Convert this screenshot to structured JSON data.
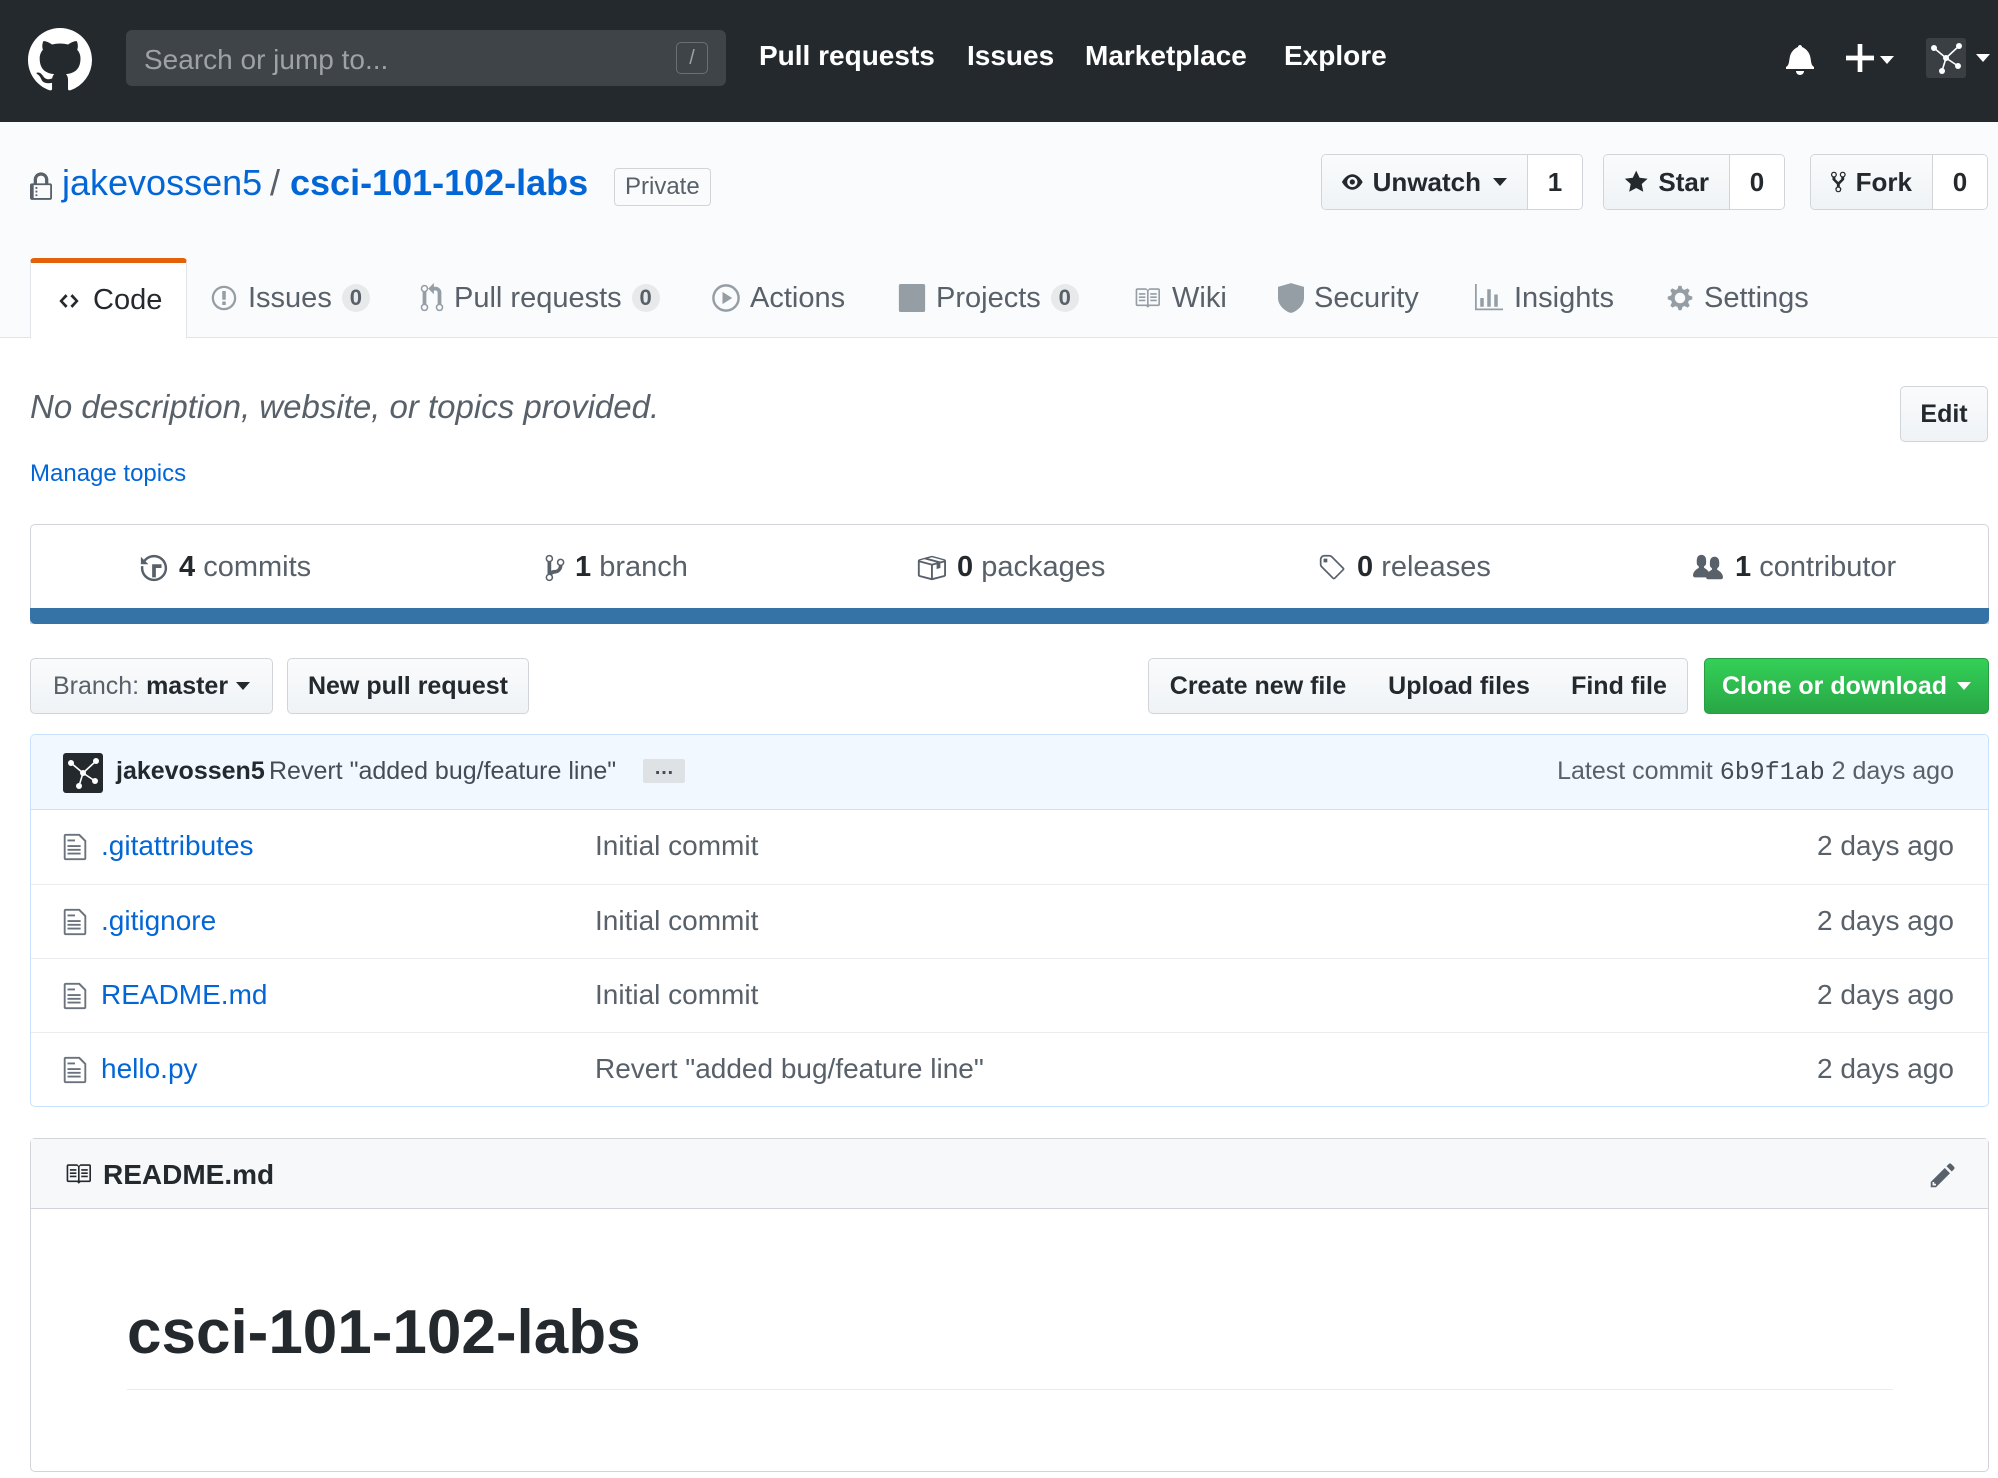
{
  "header": {
    "search_placeholder": "Search or jump to...",
    "search_shortcut": "/",
    "nav": [
      "Pull requests",
      "Issues",
      "Marketplace",
      "Explore"
    ],
    "icons": [
      "github-logo-icon",
      "bell-icon",
      "plus-icon",
      "avatar-icon"
    ]
  },
  "repo": {
    "owner": "jakevossen5",
    "separator": "/",
    "name": "csci-101-102-labs",
    "visibility": "Private",
    "unwatch_label": "Unwatch",
    "watch_count": "1",
    "star_label": "Star",
    "star_count": "0",
    "fork_label": "Fork",
    "fork_count": "0"
  },
  "tabs": [
    {
      "label": "Code",
      "icon": "code-icon",
      "counter": ""
    },
    {
      "label": "Issues",
      "icon": "issue-icon",
      "counter": "0"
    },
    {
      "label": "Pull requests",
      "icon": "pull-request-icon",
      "counter": "0"
    },
    {
      "label": "Actions",
      "icon": "play-icon",
      "counter": ""
    },
    {
      "label": "Projects",
      "icon": "project-icon",
      "counter": "0"
    },
    {
      "label": "Wiki",
      "icon": "book-icon",
      "counter": ""
    },
    {
      "label": "Security",
      "icon": "shield-icon",
      "counter": ""
    },
    {
      "label": "Insights",
      "icon": "graph-icon",
      "counter": ""
    },
    {
      "label": "Settings",
      "icon": "gear-icon",
      "counter": ""
    }
  ],
  "description": {
    "text": "No description, website, or topics provided.",
    "edit_label": "Edit",
    "manage_topics": "Manage topics"
  },
  "summary": [
    {
      "count": "4",
      "label": "commits",
      "icon": "history-icon"
    },
    {
      "count": "1",
      "label": "branch",
      "icon": "branch-icon"
    },
    {
      "count": "0",
      "label": "packages",
      "icon": "package-icon"
    },
    {
      "count": "0",
      "label": "releases",
      "icon": "tag-icon"
    },
    {
      "count": "1",
      "label": "contributor",
      "icon": "people-icon"
    }
  ],
  "language_color": "#3572a5",
  "file_nav": {
    "branch_prefix": "Branch:",
    "branch_name": "master",
    "new_pr": "New pull request",
    "create_file": "Create new file",
    "upload_files": "Upload files",
    "find_file": "Find file",
    "clone": "Clone or download"
  },
  "latest_commit": {
    "author": "jakevossen5",
    "message": "Revert \"added bug/feature line\"",
    "ellipsis": "…",
    "prefix": "Latest commit",
    "sha": "6b9f1ab",
    "age": "2 days ago"
  },
  "files": [
    {
      "name": ".gitattributes",
      "message": "Initial commit",
      "age": "2 days ago"
    },
    {
      "name": ".gitignore",
      "message": "Initial commit",
      "age": "2 days ago"
    },
    {
      "name": "README.md",
      "message": "Initial commit",
      "age": "2 days ago"
    },
    {
      "name": "hello.py",
      "message": "Revert \"added bug/feature line\"",
      "age": "2 days ago"
    }
  ],
  "readme": {
    "filename": "README.md",
    "heading": "csci-101-102-labs"
  }
}
